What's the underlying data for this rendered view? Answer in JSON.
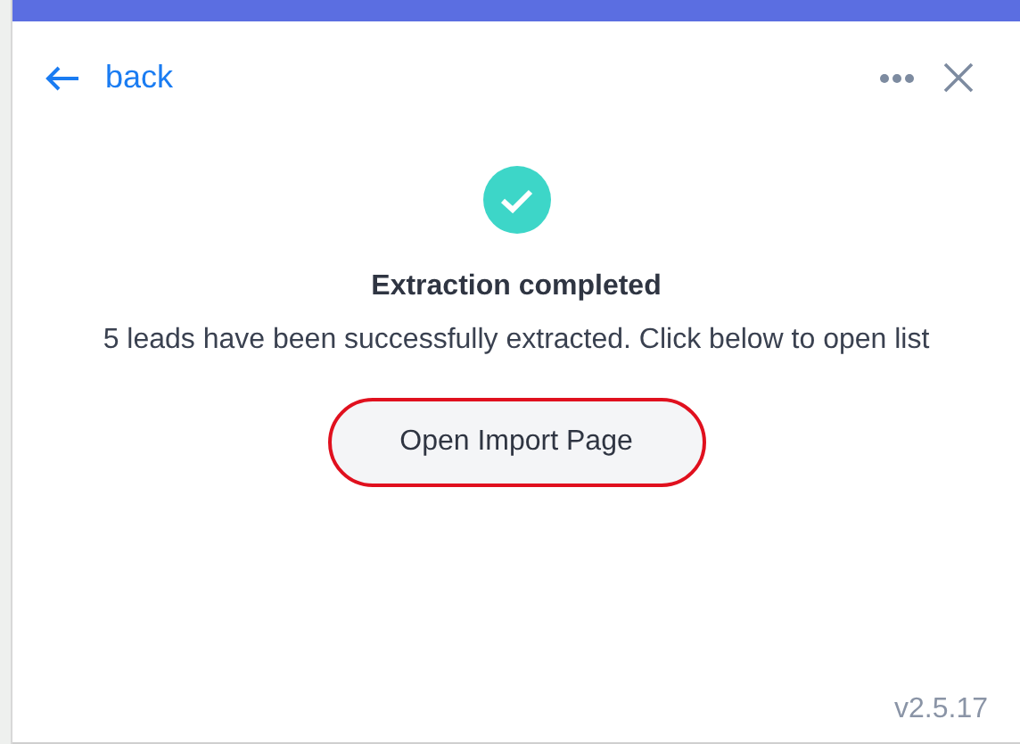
{
  "header": {
    "back_label": "back"
  },
  "message": {
    "title": "Extraction completed",
    "body": "5 leads have been successfully extracted. Click below to open list"
  },
  "button": {
    "label": "Open Import Page",
    "focused": true
  },
  "version": "v2.5.17"
}
